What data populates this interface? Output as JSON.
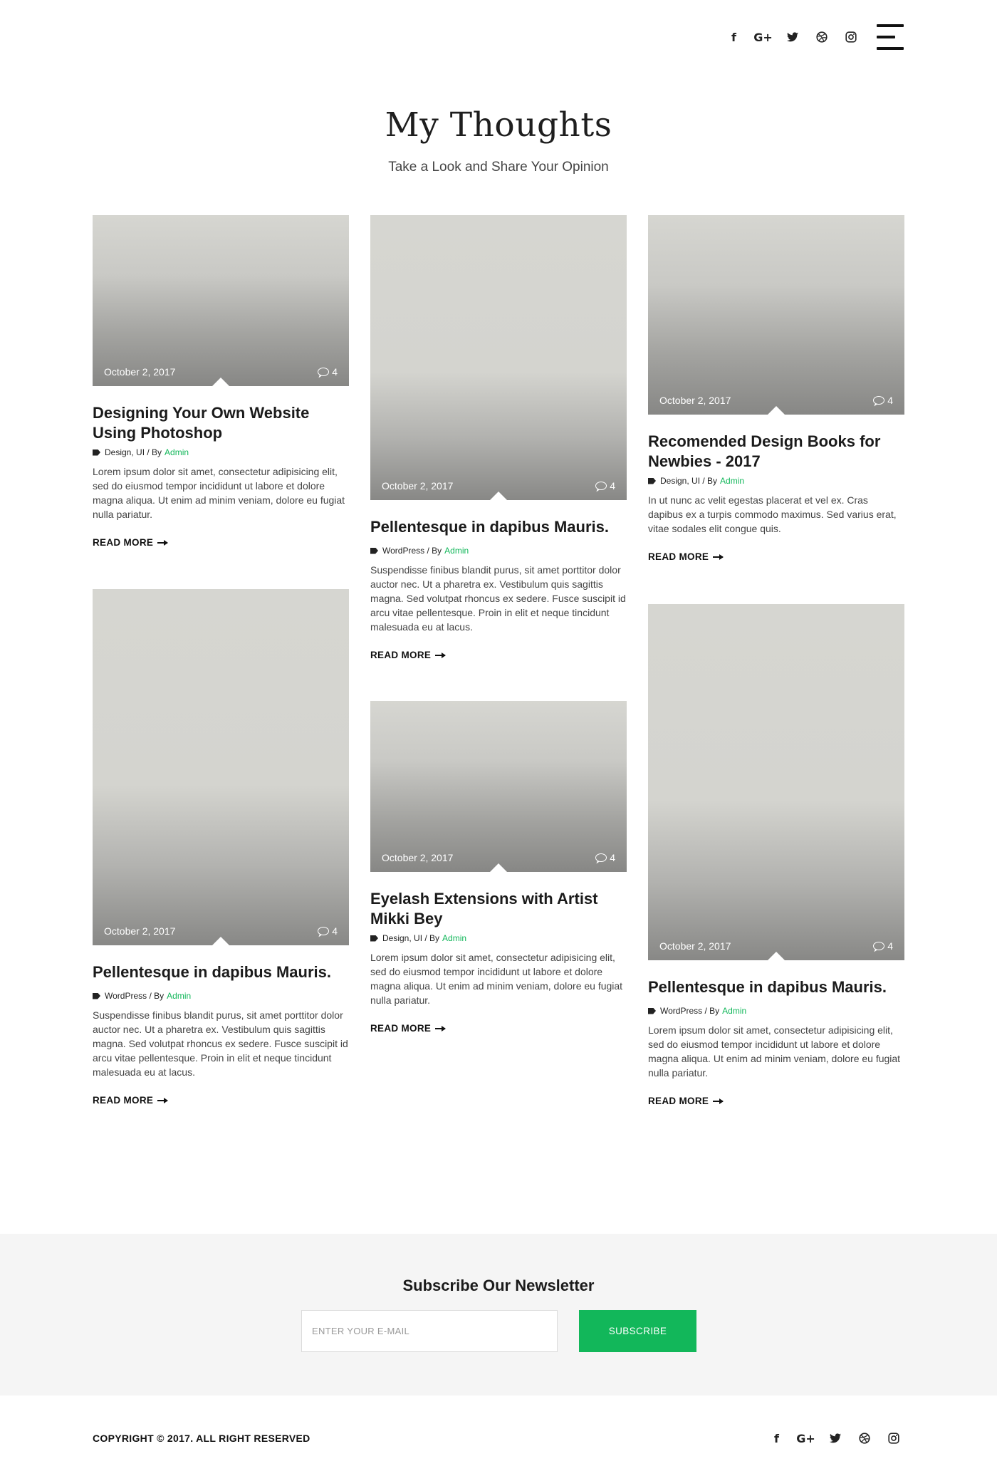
{
  "header": {
    "social": [
      {
        "icon": "facebook-icon",
        "glyph": "f"
      },
      {
        "icon": "google-plus-icon",
        "glyph": "G+"
      },
      {
        "icon": "twitter-icon",
        "glyph": "🐦"
      },
      {
        "icon": "dribbble-icon",
        "glyph": "◍"
      },
      {
        "icon": "instagram-icon",
        "glyph": "◎"
      }
    ]
  },
  "hero": {
    "title": "My Thoughts",
    "subtitle": "Take a Look and Share Your Opinion"
  },
  "posts": [
    {
      "date": "October 2, 2017",
      "comments": "4",
      "title_line1": "Designing Your Own Website",
      "title_line2": "Using Photoshop",
      "categories": "Design, UI / By",
      "author": "Admin",
      "excerpt": "Lorem ipsum dolor sit amet, consectetur adipisicing elit, sed do eiusmod tempor incididunt ut labore et dolore magna aliqua. Ut enim ad minim veniam, dolore eu fugiat nulla pariatur.",
      "read_more": "READ MORE"
    },
    {
      "date": "October 2, 2017",
      "comments": "4",
      "title_line1": "Pellentesque in dapibus Mauris.",
      "title_line2": "",
      "categories": "WordPress / By",
      "author": "Admin",
      "excerpt": "Suspendisse finibus blandit purus, sit amet porttitor dolor auctor nec. Ut a pharetra ex. Vestibulum quis sagittis magna. Sed volutpat rhoncus ex sedere. Fusce suscipit id arcu vitae pellentesque. Proin in elit et neque tincidunt malesuada eu at lacus.",
      "read_more": "READ MORE"
    },
    {
      "date": "October 2, 2017",
      "comments": "4",
      "title_line1": "Recomended Design Books for",
      "title_line2": "Newbies - 2017",
      "categories": "Design, UI / By",
      "author": "Admin",
      "excerpt": "In ut nunc ac velit egestas placerat et vel ex. Cras dapibus ex a turpis commodo maximus. Sed varius erat, vitae sodales elit congue quis.",
      "read_more": "READ MORE"
    },
    {
      "date": "October 2, 2017",
      "comments": "4",
      "title_line1": "Pellentesque in dapibus Mauris.",
      "title_line2": "",
      "categories": "WordPress / By",
      "author": "Admin",
      "excerpt": "Suspendisse finibus blandit purus, sit amet porttitor dolor auctor nec. Ut a pharetra ex. Vestibulum quis sagittis magna. Sed volutpat rhoncus ex sedere. Fusce suscipit id arcu vitae pellentesque. Proin in elit et neque tincidunt malesuada eu at lacus.",
      "read_more": "READ MORE"
    },
    {
      "date": "October 2, 2017",
      "comments": "4",
      "title_line1": "Eyelash Extensions with Artist",
      "title_line2": "Mikki Bey",
      "categories": "Design, UI / By",
      "author": "Admin",
      "excerpt": "Lorem ipsum dolor sit amet, consectetur adipisicing elit, sed do eiusmod tempor incididunt ut labore et dolore magna aliqua. Ut enim ad minim veniam, dolore eu fugiat nulla pariatur.",
      "read_more": "READ MORE"
    },
    {
      "date": "October 2, 2017",
      "comments": "4",
      "title_line1": "Pellentesque in dapibus Mauris.",
      "title_line2": "",
      "categories": "WordPress / By",
      "author": "Admin",
      "excerpt": "Lorem ipsum dolor sit amet, consectetur adipisicing elit, sed do eiusmod tempor incididunt ut labore et dolore magna aliqua. Ut enim ad minim veniam, dolore eu fugiat nulla pariatur.",
      "read_more": "READ MORE"
    }
  ],
  "newsletter": {
    "title": "Subscribe Our Newsletter",
    "placeholder": "ENTER YOUR E-MAIL",
    "button": "SUBSCRIBE"
  },
  "footer": {
    "copyright": "COPYRIGHT © 2017. ALL RIGHT RESERVED"
  },
  "colors": {
    "accent": "#12b75a",
    "newsletter_bg": "#f5f5f5"
  }
}
